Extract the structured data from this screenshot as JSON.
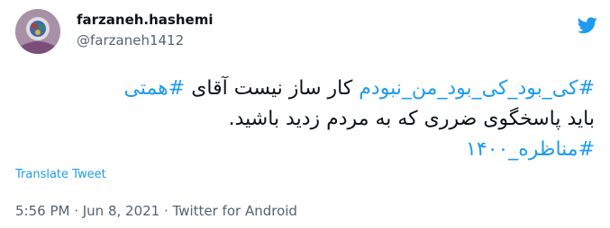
{
  "user": {
    "display_name": "farzaneh.hashemi",
    "handle": "@farzaneh1412"
  },
  "tweet": {
    "line1": {
      "hashtag_a": "#کی_بود_کی_بود_من_نبودم",
      "plain": " کار ساز نیست آقای ",
      "hashtag_b": "#همتی"
    },
    "line2": "باید پاسخگوی ضرری که به مردم زدید باشید.",
    "line3": "#مناظره_۱۴۰۰"
  },
  "translate_label": "Translate Tweet",
  "meta": {
    "time": "5:56 PM · Jun 8, 2021 · ",
    "source": "Twitter for Android"
  },
  "colors": {
    "link": "#1d9bf0",
    "text": "#0f1419",
    "secondary": "#536471"
  },
  "icons": {
    "brand": "twitter-bird-icon"
  }
}
